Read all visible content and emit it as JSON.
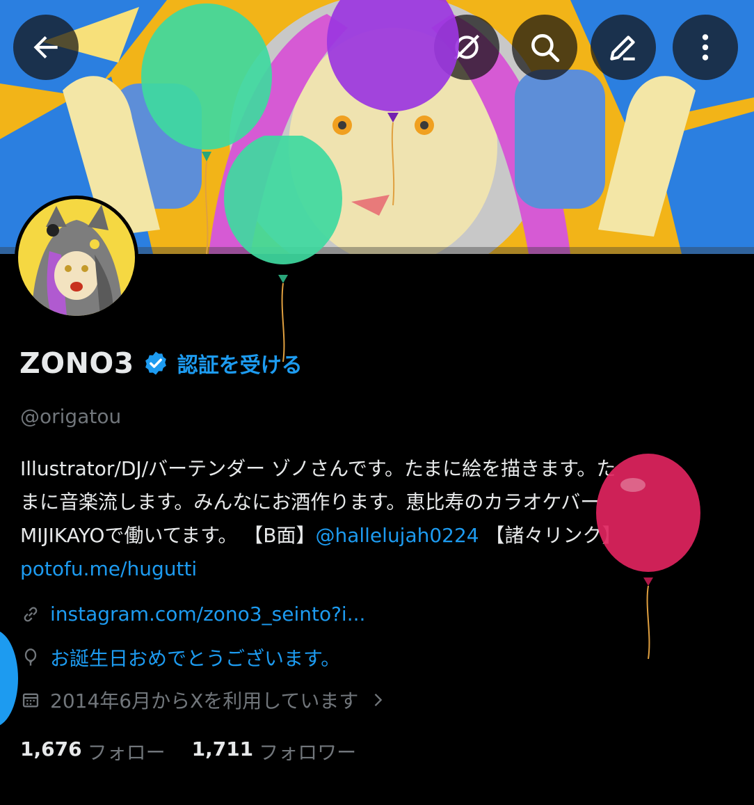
{
  "header": {
    "back_icon": "arrow-left-icon",
    "icons": [
      "no-background-icon",
      "search-icon",
      "edit-icon",
      "more-vertical-icon"
    ]
  },
  "profile": {
    "display_name": "ZONO3",
    "get_verified": "認証を受ける",
    "handle": "@origatou",
    "bio_line1": "Illustrator/DJ/バーテンダー ゾノさんです。たまに絵を描きます。た",
    "bio_line2": "まに音楽流します。みんなにお酒作ります。恵比寿のカラオケバー",
    "bio_line3a": "MIJIKAYOで働いてます。 【B面】",
    "bio_mention": "@hallelujah0224",
    "bio_line3b": " 【諸々リンク】",
    "bio_link": "potofu.me/hugutti",
    "website": "instagram.com/zono3_seinto?i...",
    "birthday": "お誕生日おめでとうございます。",
    "joined": "2014年6月からXを利用しています"
  },
  "stats": {
    "following_count": "1,676",
    "following_label": "フォロー",
    "followers_count": "1,711",
    "followers_label": "フォロワー"
  },
  "colors": {
    "accent": "#1d9bf0",
    "muted": "#71767b",
    "text": "#e7e9ea",
    "background": "#000000"
  }
}
